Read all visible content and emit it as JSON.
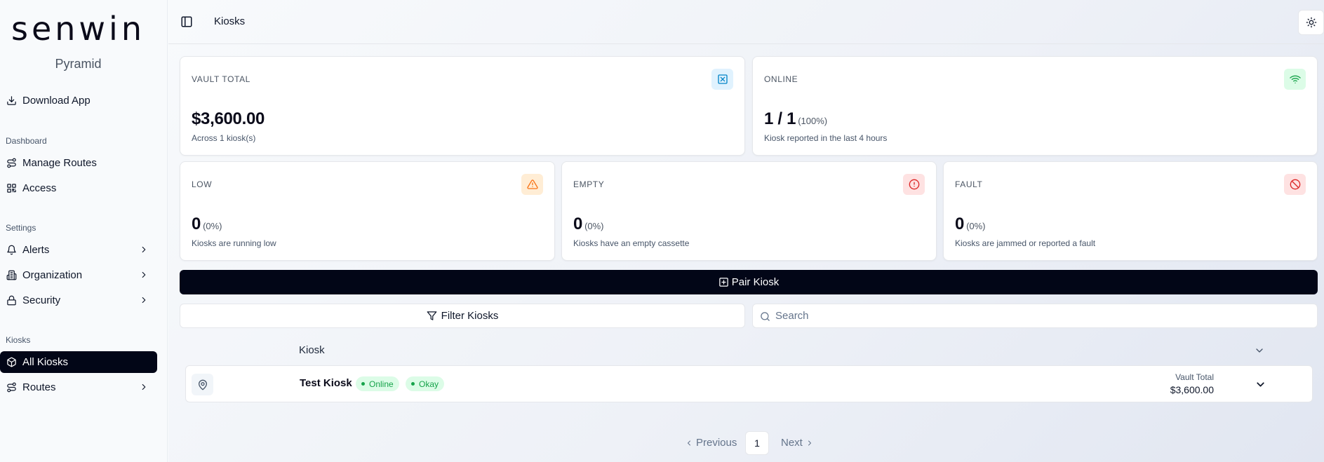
{
  "sidebar": {
    "logo": "senwin",
    "subtitle": "Pyramid",
    "download": "Download App",
    "groups": {
      "dashboard": "Dashboard",
      "settings": "Settings",
      "kiosks": "Kiosks"
    },
    "items": {
      "manage_routes": "Manage Routes",
      "access": "Access",
      "alerts": "Alerts",
      "organization": "Organization",
      "security": "Security",
      "all_kiosks": "All Kiosks",
      "routes": "Routes"
    }
  },
  "header": {
    "title": "Kiosks"
  },
  "cards": {
    "vault": {
      "label": "VAULT TOTAL",
      "value": "$3,600.00",
      "sub": "Across 1 kiosk(s)"
    },
    "online": {
      "label": "ONLINE",
      "value": "1 / 1",
      "pct": "(100%)",
      "sub": "Kiosk reported in the last 4 hours"
    },
    "low": {
      "label": "LOW",
      "value": "0",
      "pct": "(0%)",
      "sub": "Kiosks are running low"
    },
    "empty": {
      "label": "EMPTY",
      "value": "0",
      "pct": "(0%)",
      "sub": "Kiosks have an empty cassette"
    },
    "fault": {
      "label": "FAULT",
      "value": "0",
      "pct": "(0%)",
      "sub": "Kiosks are jammed or reported a fault"
    }
  },
  "actions": {
    "pair": "Pair Kiosk",
    "filter": "Filter Kiosks",
    "search_placeholder": "Search"
  },
  "table": {
    "header": "Kiosk",
    "rows": [
      {
        "name": "Test Kiosk",
        "status": "Online",
        "health": "Okay",
        "vault_label": "Vault Total",
        "vault_value": "$3,600.00"
      }
    ]
  },
  "pagination": {
    "previous": "Previous",
    "page": "1",
    "next": "Next"
  },
  "colors": {
    "primary": "#020617",
    "success": "#16a34a",
    "warning": "#f97316",
    "danger": "#dc2626",
    "info": "#0284c7"
  }
}
